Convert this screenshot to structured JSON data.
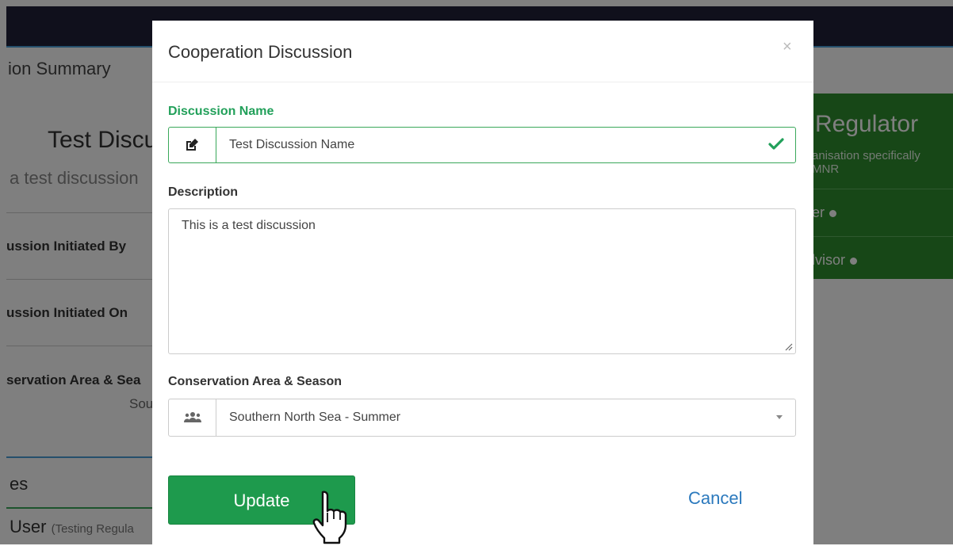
{
  "background": {
    "section_title": "ion Summary",
    "discussion_heading": "Test Discu",
    "discussion_subheading": "a test discussion",
    "initiated_by_label": "ussion Initiated By",
    "initiated_on_label": "ussion Initiated On",
    "area_label": "servation Area & Sea",
    "area_value": "Sou",
    "section2_title": "es",
    "user_name": "User",
    "user_org": "(Testing Regula",
    "regulator": {
      "title": "Regulator",
      "description_line1": "anisation specifically",
      "description_line2": "MNR",
      "item1": "er",
      "item2": "lvisor"
    }
  },
  "modal": {
    "title": "Cooperation Discussion",
    "close_symbol": "×",
    "discussion_name_label": "Discussion Name",
    "discussion_name_value": "Test Discussion Name",
    "description_label": "Description",
    "description_value": "This is a test discussion",
    "area_label": "Conservation Area & Season",
    "area_value": "Southern North Sea - Summer",
    "update_label": "Update",
    "cancel_label": "Cancel"
  },
  "colors": {
    "navbar": "#202038",
    "success_green": "#22a05a",
    "button_green": "#1e9a4d",
    "link_blue": "#2b79bd",
    "regulator_green": "#2f8f2f"
  },
  "icons": {
    "name_addon": "edit-icon",
    "name_valid": "check-icon",
    "area_addon": "users-icon",
    "area_caret": "caret-down-icon",
    "cursor": "hand-pointer-icon"
  }
}
